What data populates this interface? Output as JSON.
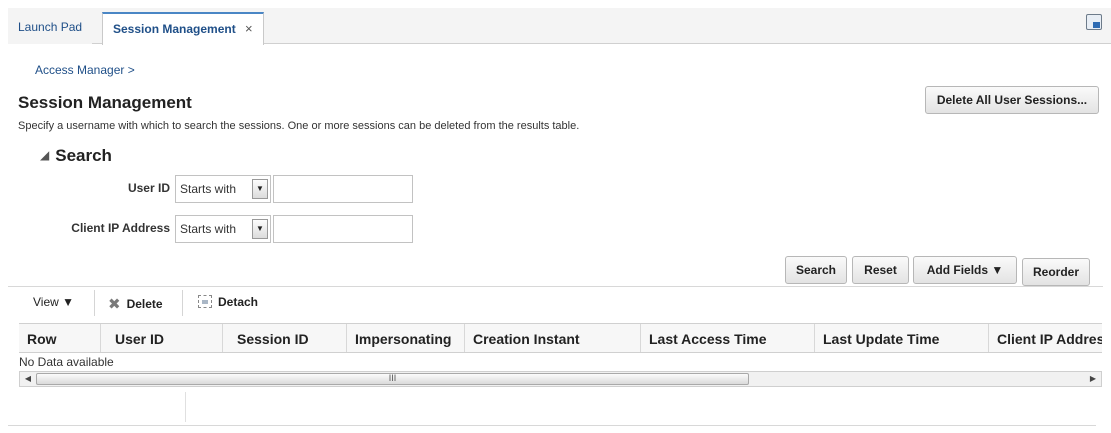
{
  "tabs": [
    {
      "label": "Launch Pad"
    },
    {
      "label": "Session Management",
      "close": "×"
    }
  ],
  "breadcrumb": "Access Manager >",
  "page": {
    "title": "Session Management",
    "description": "Specify a username with which to search the sessions. One or more sessions can be deleted from the results table.",
    "delete_all_label": "Delete All User Sessions..."
  },
  "search": {
    "header": "Search",
    "fields": [
      {
        "label": "User ID",
        "operator": "Starts with",
        "value": ""
      },
      {
        "label": "Client IP Address",
        "operator": "Starts with",
        "value": ""
      }
    ],
    "buttons": {
      "search": "Search",
      "reset": "Reset",
      "add_fields": "Add Fields ▼",
      "reorder": "Reorder"
    }
  },
  "toolbar": {
    "view": "View ▼",
    "delete": "Delete",
    "detach": "Detach"
  },
  "table": {
    "columns": [
      "Row",
      "User ID",
      "Session ID",
      "Impersonating",
      "Creation Instant",
      "Last Access Time",
      "Last Update Time",
      "Client IP Address"
    ],
    "empty_text": "No Data available",
    "scroll_grip": "III"
  },
  "colors": {
    "accent": "#4a86c5",
    "link": "#1f4f88"
  },
  "icons": [
    "close-icon",
    "detach-window-icon",
    "collapse-triangle-icon",
    "dropdown-arrow-icon",
    "delete-x-icon",
    "detach-icon",
    "scroll-left-icon",
    "scroll-right-icon"
  ]
}
